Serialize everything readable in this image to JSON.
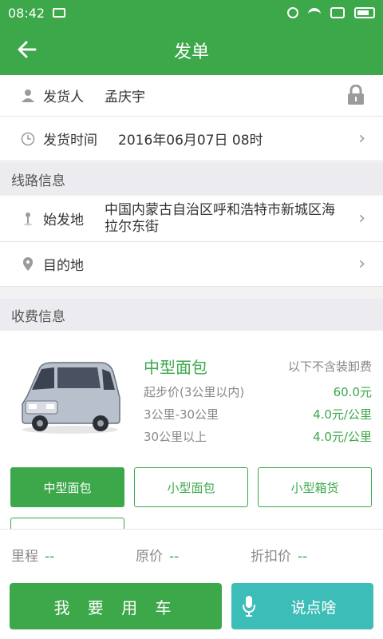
{
  "status_bar": {
    "time": "08:42"
  },
  "app_bar": {
    "title": "发单"
  },
  "shipper": {
    "label": "发货人",
    "value": "孟庆宇"
  },
  "ship_time": {
    "label": "发货时间",
    "value": "2016年06月07日 08时"
  },
  "route_section": {
    "title": "线路信息"
  },
  "origin": {
    "label": "始发地",
    "value_line1": "中国内蒙古自治区呼和浩特市新城区海",
    "value_line2": "拉尔东街"
  },
  "destination": {
    "label": "目的地"
  },
  "fee_section": {
    "title": "收费信息"
  },
  "vehicle": {
    "name": "中型面包",
    "note": "以下不含装卸费",
    "fees": [
      {
        "key": "起步价(3公里以内)",
        "value": "60.0元"
      },
      {
        "key": "3公里-30公里",
        "value": "4.0元/公里"
      },
      {
        "key": "30公里以上",
        "value": "4.0元/公里"
      }
    ]
  },
  "vehicle_types": [
    "中型面包",
    "小型面包",
    "小型箱货"
  ],
  "summary": {
    "mileage_label": "里程",
    "mileage_value": "--",
    "original_label": "原价",
    "original_value": "--",
    "discount_label": "折扣价",
    "discount_value": "--"
  },
  "actions": {
    "use_car": "我 要 用 车",
    "talk": "说点啥"
  },
  "colors": {
    "primary": "#3ca84a",
    "teal": "#3dbdb7",
    "section_bg": "#ececf0"
  }
}
